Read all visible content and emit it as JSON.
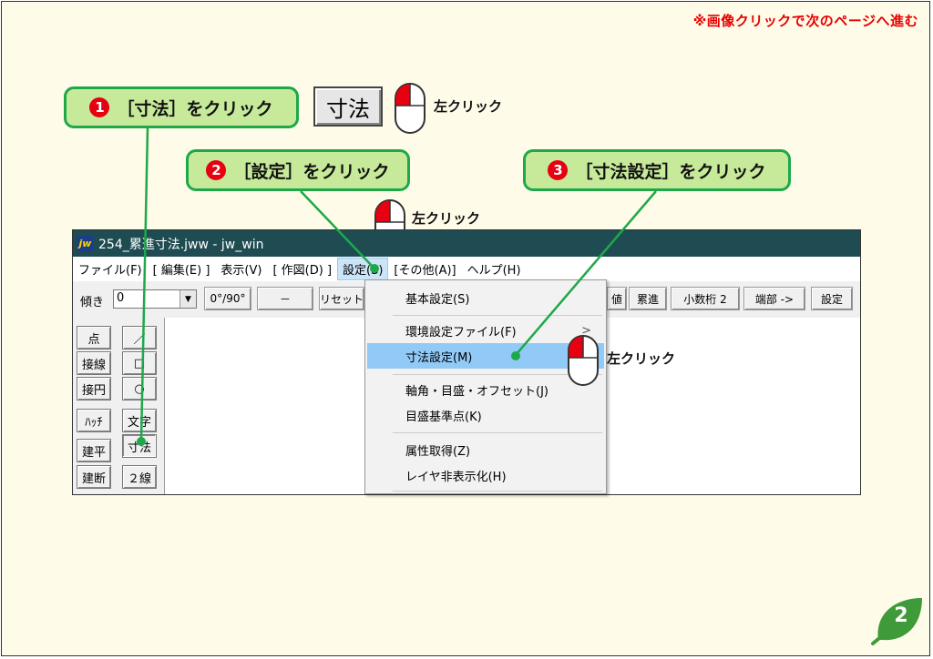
{
  "note": "※画像クリックで次のページへ進む",
  "callouts": [
    {
      "num": "1",
      "text": "［寸法］をクリック"
    },
    {
      "num": "2",
      "text": "［設定］をクリック"
    },
    {
      "num": "3",
      "text": "［寸法設定］をクリック"
    }
  ],
  "big_button_label": "寸法",
  "left_click": "左クリック",
  "window": {
    "title": "254_累進寸法.jww - jw_win",
    "logo": "jw",
    "menu": [
      "ファイル(F)",
      "[ 編集(E) ]",
      "表示(V)",
      "[ 作図(D) ]",
      "設定(S)",
      "[その他(A)]",
      "ヘルプ(H)"
    ]
  },
  "toolbar": {
    "tilt_label": "傾き",
    "tilt_value": "0",
    "angle_button": "0°/90°",
    "minus_button": "－",
    "reset_button": "リセット",
    "value_button": "値",
    "cumulative_button": "累進",
    "decimal_button": "小数桁 2",
    "end_button": "端部 ->",
    "settings_button": "設定"
  },
  "tools_left": [
    "点",
    "接線",
    "接円",
    "ﾊｯﾁ",
    "建平",
    "建断"
  ],
  "tools_right": [
    "／",
    "□",
    "○",
    "文字",
    "寸法",
    "２線"
  ],
  "dropdown": {
    "items": [
      "基本設定(S)",
      "環境設定ファイル(F)",
      "寸法設定(M)",
      "軸角・目盛・オフセット(J)",
      "目盛基準点(K)",
      "属性取得(Z)",
      "レイヤ非表示化(H)"
    ],
    "submenu_arrow": ">"
  },
  "page_number": "2",
  "colors": {
    "callout_fill": "#c7ea9a",
    "callout_border": "#1ea84a",
    "accent_red": "#e60012",
    "titlebar": "#1f4c52",
    "highlight": "#91c9f7"
  }
}
